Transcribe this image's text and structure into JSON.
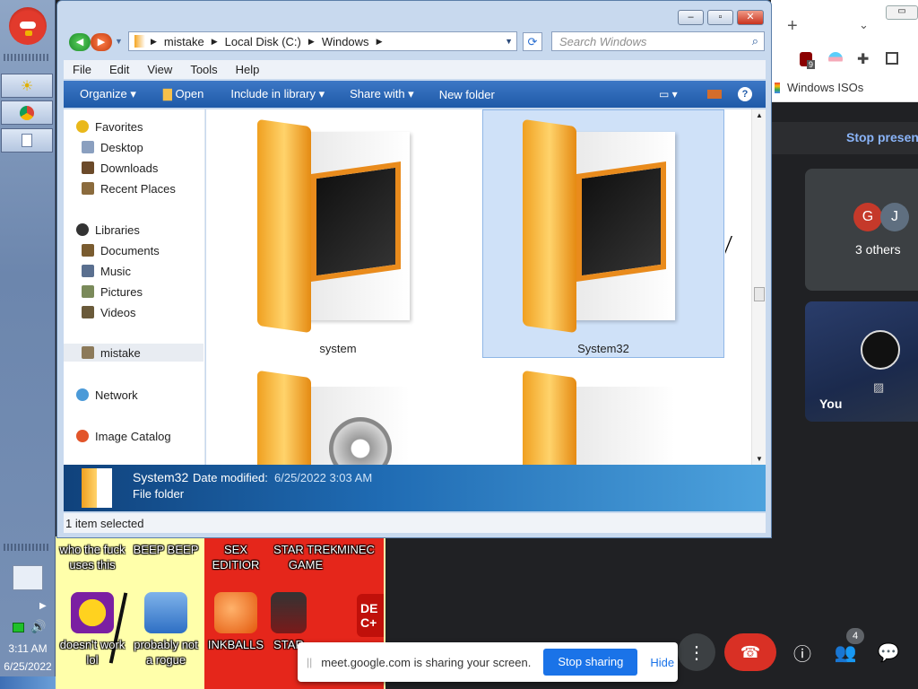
{
  "explorer": {
    "breadcrumb": [
      "mistake",
      "Local Disk (C:)",
      "Windows"
    ],
    "search_placeholder": "Search Windows",
    "menu": [
      "File",
      "Edit",
      "View",
      "Tools",
      "Help"
    ],
    "commands": [
      "Organize",
      "Open",
      "Include in library",
      "Share with",
      "New folder"
    ],
    "nav": {
      "favorites": "Favorites",
      "favorites_items": [
        "Desktop",
        "Downloads",
        "Recent Places"
      ],
      "libraries": "Libraries",
      "libraries_items": [
        "Documents",
        "Music",
        "Pictures",
        "Videos"
      ],
      "homegroup": "mistake",
      "network": "Network",
      "catalog": "Image Catalog"
    },
    "items": [
      {
        "name": "system",
        "selected": false
      },
      {
        "name": "System32",
        "selected": true
      },
      {
        "name": "",
        "selected": false
      },
      {
        "name": "",
        "selected": false
      }
    ],
    "details": {
      "name": "System32",
      "modified_label": "Date modified:",
      "modified_value": "6/25/2022 3:03 AM",
      "type": "File folder"
    },
    "status": "1 item selected"
  },
  "desktop": {
    "labels": [
      "who the fuck uses this",
      "BEEP BEEP",
      "SEX EDITIOR",
      "STAR TREK GAME",
      "MINEC"
    ],
    "icons": [
      "doesn't work lol",
      "probably not a rogue",
      "INKBALLS",
      "STAR"
    ]
  },
  "tray": {
    "time": "3:11 AM",
    "date": "6/25/2022"
  },
  "browser": {
    "bookmark": "Windows ISOs",
    "extension_badge": "9"
  },
  "meet": {
    "stop_presenting": "Stop presen",
    "others_count": "3 others",
    "avatars": [
      "G",
      "J"
    ],
    "self_label": "You",
    "people_badge": "4",
    "banner_text": "meet.google.com is sharing your screen.",
    "stop_sharing": "Stop sharing",
    "hide": "Hide"
  },
  "colors": {
    "accent": "#1a73e8",
    "end_call": "#d93025",
    "cmdbar": "#1e5aa8",
    "desktop_red": "#e5261b",
    "desktop_yellow": "#ffffaa"
  }
}
